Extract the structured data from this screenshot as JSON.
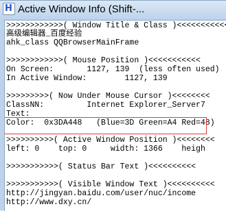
{
  "window": {
    "title": "Active Window Info (Shift-...",
    "icon": "autohotkey-icon",
    "icon_glyph": "H"
  },
  "lines": [
    ">>>>>>>>>>>>( Window Title & Class )<<<<<<<<<<<",
    "高级编辑器_百度经验",
    "ahk_class QQBrowserMainFrame",
    "",
    ">>>>>>>>>>>>( Mouse Position )<<<<<<<<<<<",
    "On Screen:       1127, 139  (less often used)",
    "In Active Window:        1127, 139",
    "",
    ">>>>>>>>>( Now Under Mouse Cursor )<<<<<<<<",
    "ClassNN:         Internet Explorer_Server7",
    "Text:",
    "Color:  0x3DA448   (Blue=3D Green=A4 Red=48)",
    "",
    ">>>>>>>>>>( Active Window Position )<<<<<<<<",
    "left: 0    top: 0     width: 1366    heigh",
    "",
    ">>>>>>>>>>>( Status Bar Text )<<<<<<<<<<",
    "",
    ">>>>>>>>>>>( Visible Window Text )<<<<<<<<<<",
    "http://jingyan.baidu.com/user/nuc/income",
    "http://www.dxy.cn/"
  ],
  "highlight": {
    "color": "#e8363a",
    "target": "color-and-section-header"
  }
}
